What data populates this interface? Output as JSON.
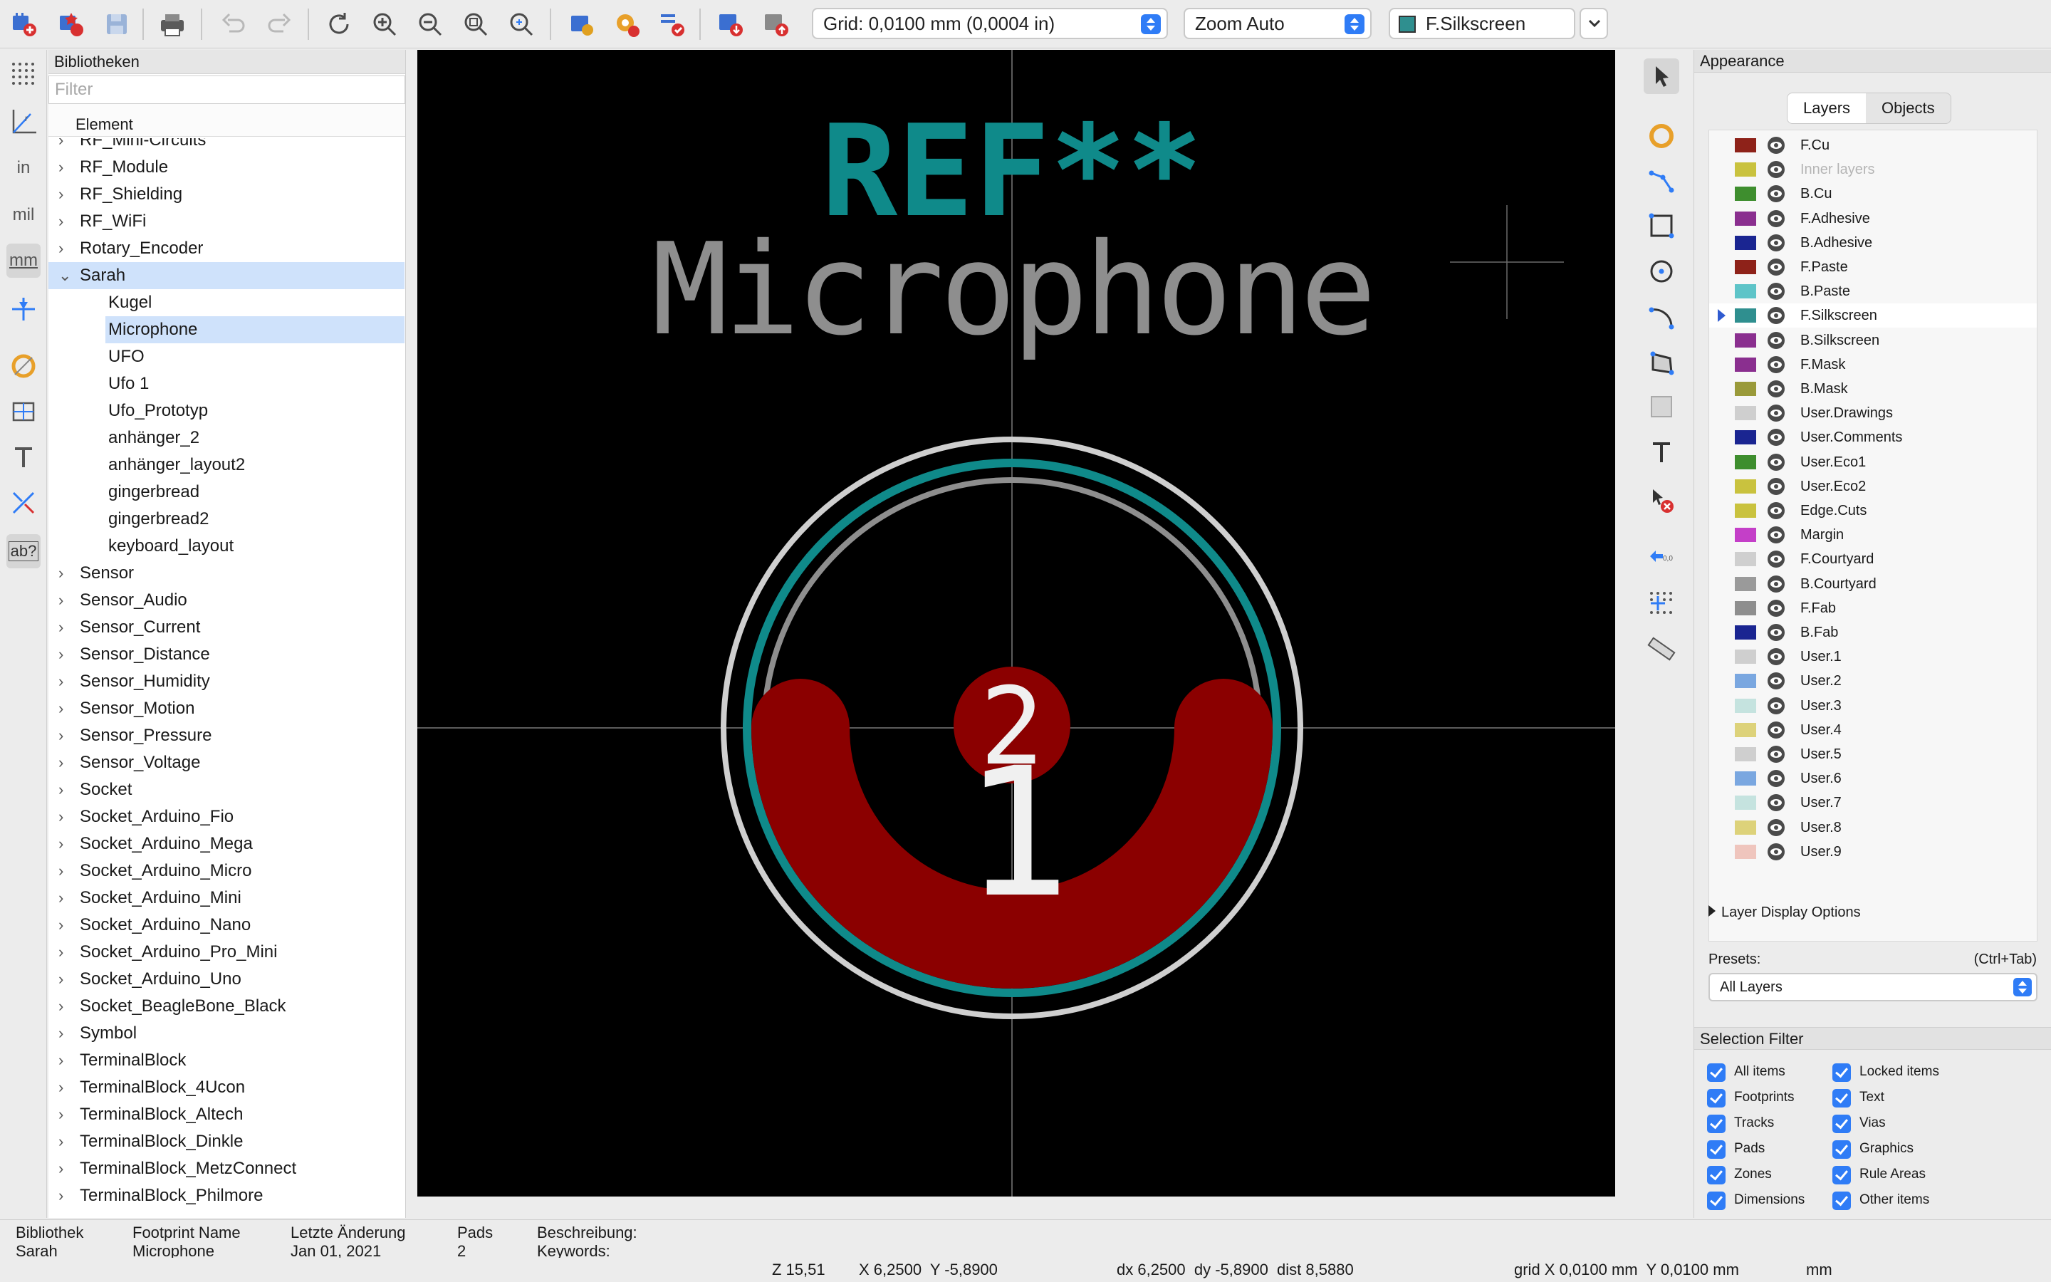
{
  "toolbar": {
    "grid_label": "Grid: 0,0100 mm (0,0004 in)",
    "zoom_label": "Zoom Auto",
    "layer_label": "F.Silkscreen",
    "layer_color": "#2f8f8f"
  },
  "left_toolbar": {
    "unit_in": "in",
    "unit_mil": "mil",
    "unit_mm": "mm",
    "text_tool": "ab?"
  },
  "library": {
    "title": "Bibliotheken",
    "filter_placeholder": "Filter",
    "column_header": "Element",
    "items": [
      {
        "label": "RF_Mini-Circuits",
        "expanded": false,
        "child": false
      },
      {
        "label": "RF_Module",
        "expanded": false,
        "child": false
      },
      {
        "label": "RF_Shielding",
        "expanded": false,
        "child": false
      },
      {
        "label": "RF_WiFi",
        "expanded": false,
        "child": false
      },
      {
        "label": "Rotary_Encoder",
        "expanded": false,
        "child": false
      },
      {
        "label": "Sarah",
        "expanded": true,
        "child": false,
        "selected": true
      },
      {
        "label": "Kugel",
        "child": true
      },
      {
        "label": "Microphone",
        "child": true,
        "selected": true
      },
      {
        "label": "UFO",
        "child": true
      },
      {
        "label": "Ufo 1",
        "child": true
      },
      {
        "label": "Ufo_Prototyp",
        "child": true
      },
      {
        "label": "anhänger_2",
        "child": true
      },
      {
        "label": "anhänger_layout2",
        "child": true
      },
      {
        "label": "gingerbread",
        "child": true
      },
      {
        "label": "gingerbread2",
        "child": true
      },
      {
        "label": "keyboard_layout",
        "child": true
      },
      {
        "label": "Sensor",
        "expanded": false,
        "child": false
      },
      {
        "label": "Sensor_Audio",
        "expanded": false,
        "child": false
      },
      {
        "label": "Sensor_Current",
        "expanded": false,
        "child": false
      },
      {
        "label": "Sensor_Distance",
        "expanded": false,
        "child": false
      },
      {
        "label": "Sensor_Humidity",
        "expanded": false,
        "child": false
      },
      {
        "label": "Sensor_Motion",
        "expanded": false,
        "child": false
      },
      {
        "label": "Sensor_Pressure",
        "expanded": false,
        "child": false
      },
      {
        "label": "Sensor_Voltage",
        "expanded": false,
        "child": false
      },
      {
        "label": "Socket",
        "expanded": false,
        "child": false
      },
      {
        "label": "Socket_Arduino_Fio",
        "expanded": false,
        "child": false
      },
      {
        "label": "Socket_Arduino_Mega",
        "expanded": false,
        "child": false
      },
      {
        "label": "Socket_Arduino_Micro",
        "expanded": false,
        "child": false
      },
      {
        "label": "Socket_Arduino_Mini",
        "expanded": false,
        "child": false
      },
      {
        "label": "Socket_Arduino_Nano",
        "expanded": false,
        "child": false
      },
      {
        "label": "Socket_Arduino_Pro_Mini",
        "expanded": false,
        "child": false
      },
      {
        "label": "Socket_Arduino_Uno",
        "expanded": false,
        "child": false
      },
      {
        "label": "Socket_BeagleBone_Black",
        "expanded": false,
        "child": false
      },
      {
        "label": "Symbol",
        "expanded": false,
        "child": false
      },
      {
        "label": "TerminalBlock",
        "expanded": false,
        "child": false
      },
      {
        "label": "TerminalBlock_4Ucon",
        "expanded": false,
        "child": false
      },
      {
        "label": "TerminalBlock_Altech",
        "expanded": false,
        "child": false
      },
      {
        "label": "TerminalBlock_Dinkle",
        "expanded": false,
        "child": false
      },
      {
        "label": "TerminalBlock_MetzConnect",
        "expanded": false,
        "child": false
      },
      {
        "label": "TerminalBlock_Philmore",
        "expanded": false,
        "child": false
      }
    ]
  },
  "canvas": {
    "reference_text": "REF**",
    "value_text": "Microphone",
    "pad1_label": "1",
    "pad2_label": "2",
    "reference_color": "#0f8a8a",
    "value_color": "#8e8e8e",
    "pad_color": "#8b0000"
  },
  "appearance": {
    "title": "Appearance",
    "tab_layers": "Layers",
    "tab_objects": "Objects",
    "layers": [
      {
        "name": "F.Cu",
        "color": "#8e2219"
      },
      {
        "name": "Inner layers",
        "color": "#c9c23e",
        "dim": true
      },
      {
        "name": "B.Cu",
        "color": "#3e8e2e"
      },
      {
        "name": "F.Adhesive",
        "color": "#8a2f8f"
      },
      {
        "name": "B.Adhesive",
        "color": "#1a2591"
      },
      {
        "name": "F.Paste",
        "color": "#8e2219"
      },
      {
        "name": "B.Paste",
        "color": "#5ec4c8"
      },
      {
        "name": "F.Silkscreen",
        "color": "#2f8f8f",
        "active": true
      },
      {
        "name": "B.Silkscreen",
        "color": "#8a2f8f"
      },
      {
        "name": "F.Mask",
        "color": "#8a2f8f"
      },
      {
        "name": "B.Mask",
        "color": "#9a9a3a"
      },
      {
        "name": "User.Drawings",
        "color": "#cfcfcf"
      },
      {
        "name": "User.Comments",
        "color": "#1a2591"
      },
      {
        "name": "User.Eco1",
        "color": "#3e8e2e"
      },
      {
        "name": "User.Eco2",
        "color": "#c9c23e"
      },
      {
        "name": "Edge.Cuts",
        "color": "#c9c23e"
      },
      {
        "name": "Margin",
        "color": "#c43fc8"
      },
      {
        "name": "F.Courtyard",
        "color": "#cfcfcf"
      },
      {
        "name": "B.Courtyard",
        "color": "#9a9a9a"
      },
      {
        "name": "F.Fab",
        "color": "#8e8e8e"
      },
      {
        "name": "B.Fab",
        "color": "#1a2591"
      },
      {
        "name": "User.1",
        "color": "#cfcfcf"
      },
      {
        "name": "User.2",
        "color": "#7aa7e0"
      },
      {
        "name": "User.3",
        "color": "#c5e3df"
      },
      {
        "name": "User.4",
        "color": "#ddd27a"
      },
      {
        "name": "User.5",
        "color": "#cfcfcf"
      },
      {
        "name": "User.6",
        "color": "#7aa7e0"
      },
      {
        "name": "User.7",
        "color": "#c5e3df"
      },
      {
        "name": "User.8",
        "color": "#ddd27a"
      },
      {
        "name": "User.9",
        "color": "#efc5bd"
      }
    ],
    "layer_display_options": "Layer Display Options",
    "presets_label": "Presets:",
    "presets_shortcut": "(Ctrl+Tab)",
    "presets_value": "All Layers",
    "selection_filter_title": "Selection Filter",
    "filters": [
      "All items",
      "Locked items",
      "Footprints",
      "Text",
      "Tracks",
      "Vias",
      "Pads",
      "Graphics",
      "Zones",
      "Rule Areas",
      "Dimensions",
      "Other items"
    ]
  },
  "info": {
    "lib_header": "Bibliothek",
    "lib_value": "Sarah",
    "fp_header": "Footprint Name",
    "fp_value": "Microphone",
    "mod_header": "Letzte Änderung",
    "mod_value": "Jan 01, 2021",
    "pads_header": "Pads",
    "pads_value": "2",
    "desc_label": "Beschreibung:",
    "kw_label": "Keywords:"
  },
  "status": {
    "zoom": "Z 15,51",
    "xy": "X 6,2500  Y -5,8900",
    "dxy": "dx 6,2500  dy -5,8900  dist 8,5880",
    "grid": "grid X 0,0100 mm  Y 0,0100 mm",
    "units": "mm"
  }
}
